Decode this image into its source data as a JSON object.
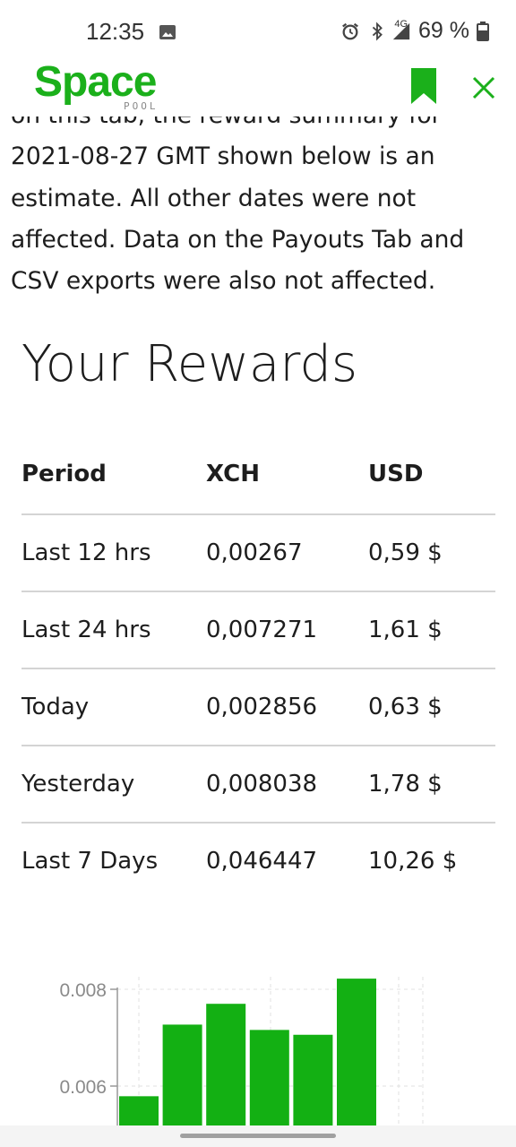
{
  "status_bar": {
    "time": "12:35",
    "network": "4G",
    "battery": "69 %",
    "icons": [
      "image-icon",
      "alarm-icon",
      "bluetooth-icon",
      "signal-icon",
      "battery-icon"
    ]
  },
  "app": {
    "logo_text": "Space",
    "logo_subtext": "POOL",
    "brand_color": "#1bb01b",
    "icons": [
      "bookmark-icon",
      "close-icon"
    ]
  },
  "notice": {
    "text": "on this tab, the reward summary for 2021-08-27 GMT shown below is an estimate. All other dates were not affected. Data on the Payouts Tab and CSV exports were also not affected."
  },
  "rewards": {
    "title": "Your Rewards",
    "headers": [
      "Period",
      "XCH",
      "USD"
    ],
    "rows": [
      {
        "period": "Last 12 hrs",
        "xch": "0,00267",
        "usd": "0,59 $"
      },
      {
        "period": "Last 24 hrs",
        "xch": "0,007271",
        "usd": "1,61 $"
      },
      {
        "period": "Today",
        "xch": "0,002856",
        "usd": "0,63 $"
      },
      {
        "period": "Yesterday",
        "xch": "0,008038",
        "usd": "1,78 $"
      },
      {
        "period": "Last 7 Days",
        "xch": "0,046447",
        "usd": "10,26 $"
      }
    ]
  },
  "chart_data": {
    "type": "bar",
    "title": "",
    "xlabel": "",
    "ylabel": "",
    "y_tick_labels": [
      "0.008",
      "0.006"
    ],
    "ylim": [
      0.0057,
      0.0083
    ],
    "values": [
      0.00579,
      0.00727,
      0.0077,
      0.00716,
      0.00706,
      0.00822
    ],
    "bar_color": "#13b013",
    "grid": true
  }
}
